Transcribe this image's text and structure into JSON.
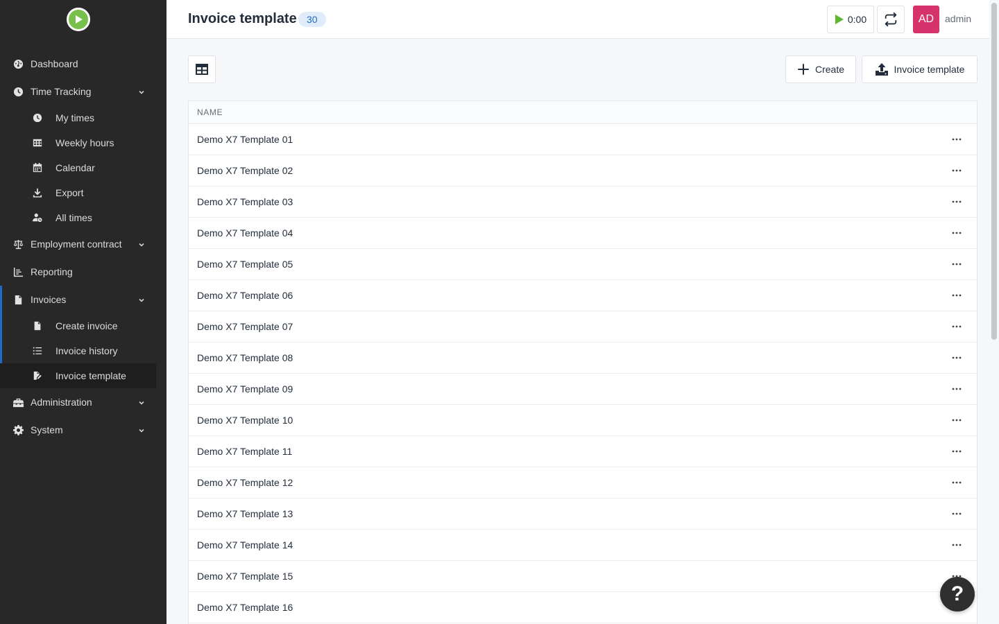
{
  "sidebar": {
    "logo_icon": "play-circle-icon",
    "items": [
      {
        "label": "Dashboard",
        "icon": "dashboard-icon"
      },
      {
        "label": "Time Tracking",
        "icon": "clock-icon"
      },
      {
        "label": "My times",
        "icon": "clock-icon"
      },
      {
        "label": "Weekly hours",
        "icon": "table-icon"
      },
      {
        "label": "Calendar",
        "icon": "calendar-icon"
      },
      {
        "label": "Export",
        "icon": "download-icon"
      },
      {
        "label": "All times",
        "icon": "user-clock-icon"
      },
      {
        "label": "Employment contract",
        "icon": "balance-scale-icon"
      },
      {
        "label": "Reporting",
        "icon": "chart-icon"
      },
      {
        "label": "Invoices",
        "icon": "file-invoice-icon"
      },
      {
        "label": "Create invoice",
        "icon": "file-icon"
      },
      {
        "label": "Invoice history",
        "icon": "list-icon"
      },
      {
        "label": "Invoice template",
        "icon": "file-signature-icon"
      },
      {
        "label": "Administration",
        "icon": "toolbox-icon"
      },
      {
        "label": "System",
        "icon": "gear-icon"
      }
    ],
    "active_item": "Invoice template"
  },
  "header": {
    "title": "Invoice template",
    "count": "30",
    "timer": "0:00",
    "avatar_initials": "AD",
    "username": "admin"
  },
  "toolbar": {
    "create_label": "Create",
    "upload_label": "Invoice template"
  },
  "table": {
    "column_name": "NAME",
    "rows": [
      "Demo X7 Template 01",
      "Demo X7 Template 02",
      "Demo X7 Template 03",
      "Demo X7 Template 04",
      "Demo X7 Template 05",
      "Demo X7 Template 06",
      "Demo X7 Template 07",
      "Demo X7 Template 08",
      "Demo X7 Template 09",
      "Demo X7 Template 10",
      "Demo X7 Template 11",
      "Demo X7 Template 12",
      "Demo X7 Template 13",
      "Demo X7 Template 14",
      "Demo X7 Template 15",
      "Demo X7 Template 16"
    ]
  },
  "help_label": "?",
  "colors": {
    "sidebar_bg": "#282828",
    "accent": "#206bc4",
    "avatar": "#d6336c",
    "logo": "#76c04b"
  }
}
